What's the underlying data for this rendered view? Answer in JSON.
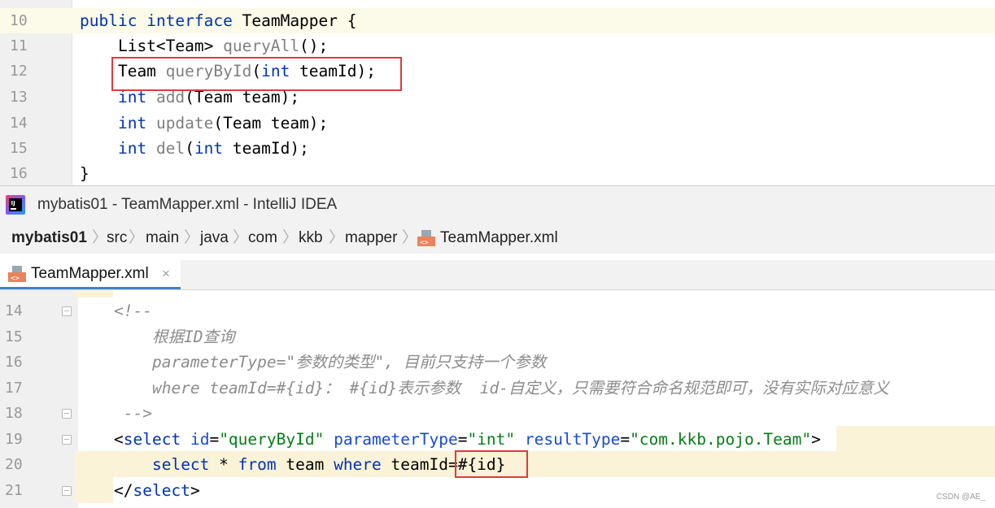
{
  "top_editor": {
    "lines": [
      {
        "num": "10",
        "code": "public interface TeamMapper {"
      },
      {
        "num": "11",
        "code": "List<Team> queryAll();"
      },
      {
        "num": "12",
        "code": "Team queryById(int teamId);"
      },
      {
        "num": "13",
        "code": "int add(Team team);"
      },
      {
        "num": "14",
        "code": "int update(Team team);"
      },
      {
        "num": "15",
        "code": "int del(int teamId);"
      },
      {
        "num": "16",
        "code": "}"
      }
    ],
    "highlight_box_label": "Team queryById(int teamId);"
  },
  "window": {
    "title": "mybatis01 - TeamMapper.xml - IntelliJ IDEA",
    "app_icon": "intellij-icon"
  },
  "breadcrumb": [
    "mybatis01",
    "src",
    "main",
    "java",
    "com",
    "kkb",
    "mapper",
    "TeamMapper.xml"
  ],
  "tab": {
    "label": "TeamMapper.xml",
    "close": "×",
    "icon": "xml-file-icon"
  },
  "bottom_editor": {
    "lines": [
      {
        "num": "14",
        "code": "<!--"
      },
      {
        "num": "15",
        "code": "    根据ID查询"
      },
      {
        "num": "16",
        "code": "    parameterType=\"参数的类型\", 目前只支持一个参数"
      },
      {
        "num": "17",
        "code": "    where teamId=#{id}： #{id}表示参数  id-自定义，只需要符合命名规范即可，没有实际对应意义"
      },
      {
        "num": "18",
        "code": " -->"
      },
      {
        "num": "19",
        "code": "<select id=\"queryById\" parameterType=\"int\" resultType=\"com.kkb.pojo.Team\">"
      },
      {
        "num": "20",
        "code": "    select * from team where teamId=#{id}"
      },
      {
        "num": "21",
        "code": "</select>"
      }
    ],
    "highlight_box_label": "#{id}"
  },
  "watermark": "CSDN @AE_",
  "colors": {
    "keyword": "#0033b3",
    "string": "#067d17",
    "comment": "#8c8c8c",
    "highlight_box": "#e0393e",
    "tab_underline": "#4083c9"
  }
}
